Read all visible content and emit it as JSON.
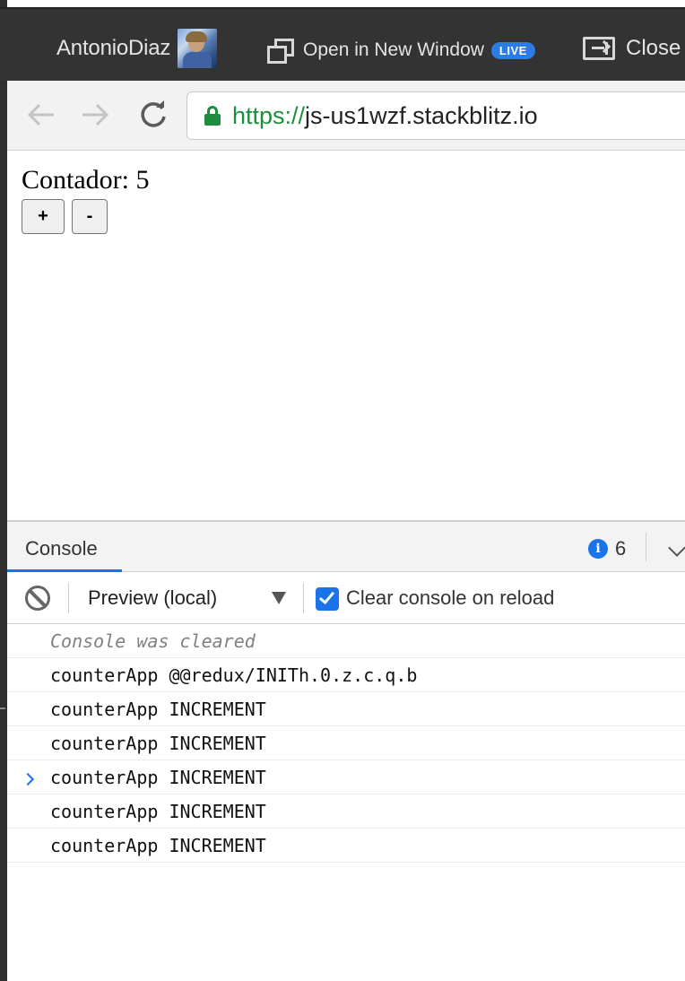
{
  "topbar": {
    "user_name": "AntonioDiaz",
    "open_window_label": "Open in New Window",
    "live_badge": "LIVE",
    "close_label": "Close"
  },
  "navbar": {
    "url_protocol": "https://",
    "url_host": "js-us1wzf.stackblitz.io"
  },
  "page": {
    "counter_text": "Contador: 5",
    "increment_label": "+",
    "decrement_label": "-"
  },
  "console": {
    "tab_label": "Console",
    "info_count": "6",
    "context_label": "Preview (local)",
    "clear_on_reload_label": "Clear console on reload",
    "clear_on_reload_checked": true,
    "logs": [
      "Console was cleared",
      "counterApp @@redux/INITh.0.z.c.q.b",
      "counterApp INCREMENT",
      "counterApp INCREMENT",
      "counterApp INCREMENT",
      "counterApp INCREMENT",
      "counterApp INCREMENT"
    ]
  },
  "colors": {
    "accent": "#1a73e8",
    "secure_green": "#1e8e3e",
    "topbar_bg": "#333333"
  }
}
